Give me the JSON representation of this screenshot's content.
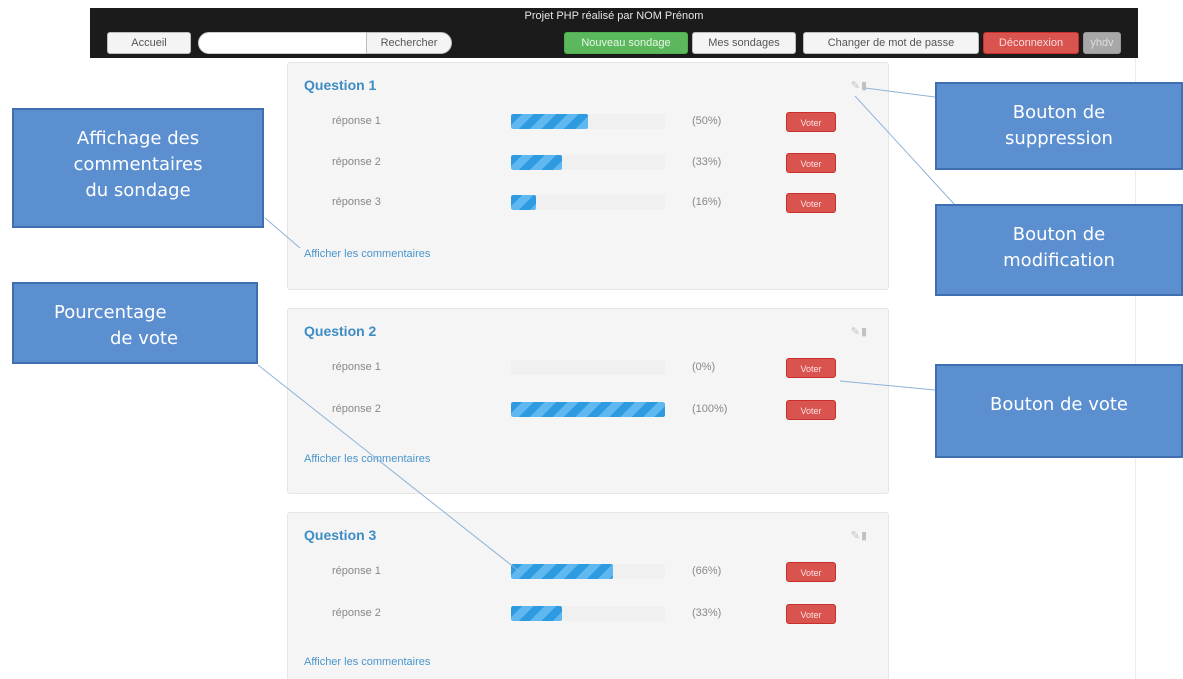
{
  "header": {
    "title": "Projet PHP réalisé par NOM Prénom",
    "home_label": "Accueil",
    "search_placeholder": "",
    "search_label": "Rechercher",
    "new_survey_label": "Nouveau sondage",
    "my_surveys_label": "Mes sondages",
    "change_password_label": "Changer de mot de passe",
    "logout_label": "Déconnexion",
    "user_label": "yhdv"
  },
  "colors": {
    "new_button": "#5cb85c",
    "vote_button": "#d9534f",
    "bar": "#2e9be0",
    "title": "#3d8cc4",
    "callout": "#5b8fd0"
  },
  "icons": [
    "edit-icon",
    "trash-icon"
  ],
  "surveys": [
    {
      "title": "Question 1",
      "comments_label": "Afficher les commentaires",
      "answers": [
        {
          "label": "réponse 1",
          "percent_text": "(50%)",
          "fraction": 0.5,
          "vote_label": "Voter"
        },
        {
          "label": "réponse 2",
          "percent_text": "(33%)",
          "fraction": 0.33,
          "vote_label": "Voter"
        },
        {
          "label": "réponse 3",
          "percent_text": "(16%)",
          "fraction": 0.16,
          "vote_label": "Voter"
        }
      ]
    },
    {
      "title": "Question 2",
      "comments_label": "Afficher les commentaires",
      "answers": [
        {
          "label": "réponse 1",
          "percent_text": "(0%)",
          "fraction": 0.0,
          "vote_label": "Voter"
        },
        {
          "label": "réponse 2",
          "percent_text": "(100%)",
          "fraction": 1.0,
          "vote_label": "Voter"
        }
      ]
    },
    {
      "title": "Question 3",
      "comments_label": "Afficher les commentaires",
      "answers": [
        {
          "label": "réponse 1",
          "percent_text": "(66%)",
          "fraction": 0.66,
          "vote_label": "Voter"
        },
        {
          "label": "réponse 2",
          "percent_text": "(33%)",
          "fraction": 0.33,
          "vote_label": "Voter"
        }
      ]
    }
  ],
  "callouts": {
    "comments": [
      "Affichage des",
      "commentaires",
      "du sondage"
    ],
    "percentage": [
      "Pourcentage",
      "de vote"
    ],
    "delete": [
      "Bouton de",
      "suppression"
    ],
    "edit": [
      "Bouton de",
      "modification"
    ],
    "vote": [
      "Bouton de vote"
    ]
  }
}
